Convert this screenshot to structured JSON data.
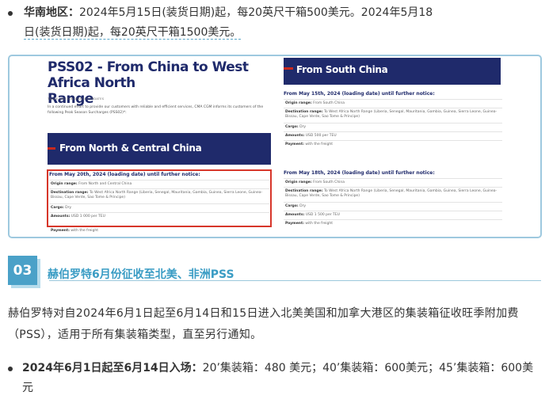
{
  "top_bullet": {
    "label": "华南地区：",
    "text_line1": "2024年5月15日(装货日期)起，每20英尺干箱500美元。2024年5月18",
    "text_line2": "日(装货日期)起，每20英尺干箱1500美元。"
  },
  "notice": {
    "title_line1": "PSS02 - From China to West Africa North",
    "title_line2": "Range",
    "subtitle": "TRADE AND SURCHARGES UPDATES",
    "intro": "In a continued effort to provide our customers with reliable and efficient services, CMA CGM informs its customers of the following Peak Season Surcharges (PSS02)*:",
    "north_label": "From North & Central China",
    "south_label": "From South China",
    "north_block": {
      "period": "From May 20th, 2024 (loading date) until further notice:",
      "origin_label": "Origin range:",
      "origin_value": "From North and Central China",
      "destination_label": "Destination range:",
      "destination_value": "To West Africa North Range (Liberia, Senegal, Mauritania, Gambia, Guinea, Sierra Leone, Guinea-Bissau, Cape Verde, Sao Tome & Principe)",
      "cargo_label": "Cargo:",
      "cargo_value": "Dry",
      "amounts_label": "Amounts:",
      "amounts_value": "USD 1 000 per TEU",
      "payment_label": "Payment:",
      "payment_value": "with the freight"
    },
    "south_block_1": {
      "period": "From May 15th, 2024 (loading date) until further notice:",
      "origin_label": "Origin range:",
      "origin_value": "From South China",
      "destination_label": "Destination range:",
      "destination_value": "To West Africa North Range (Liberia, Senegal, Mauritania, Gambia, Guinea, Sierra Leone, Guinea-Bissau, Cape Verde, Sao Tome & Principe)",
      "cargo_label": "Cargo:",
      "cargo_value": "Dry",
      "amounts_label": "Amounts:",
      "amounts_value": "USD 500 per TEU",
      "payment_label": "Payment:",
      "payment_value": "with the freight"
    },
    "south_block_2": {
      "period": "From May 18th, 2024 (loading date) until further notice:",
      "origin_label": "Origin range:",
      "origin_value": "From South China",
      "destination_label": "Destination range:",
      "destination_value": "To West Africa North Range (Liberia, Senegal, Mauritania, Gambia, Guinea, Sierra Leone, Guinea-Bissau, Cape Verde, Sao Tome & Principe)",
      "cargo_label": "Cargo:",
      "cargo_value": "Dry",
      "amounts_label": "Amounts:",
      "amounts_value": "USD 1 500 per TEU",
      "payment_label": "Payment:",
      "payment_value": "with the freight"
    }
  },
  "section": {
    "number": "03",
    "title": "赫伯罗特6月份征收至北美、非洲PSS"
  },
  "paragraph": "赫伯罗特对自2024年6月1日起至6月14日和15日进入北美美国和加拿大港区的集装箱征收旺季附加费（PSS），适用于所有集装箱类型，直至另行通知。",
  "bottom_bullet": {
    "label": "2024年6月1日起至6月14日入场：",
    "text": "20’集装箱：480 美元；40’集装箱：600美元；45’集装箱：600美元"
  },
  "colors": {
    "navy": "#1f2a6b",
    "red": "#d7362a",
    "accent_blue": "#4aa1c8"
  }
}
